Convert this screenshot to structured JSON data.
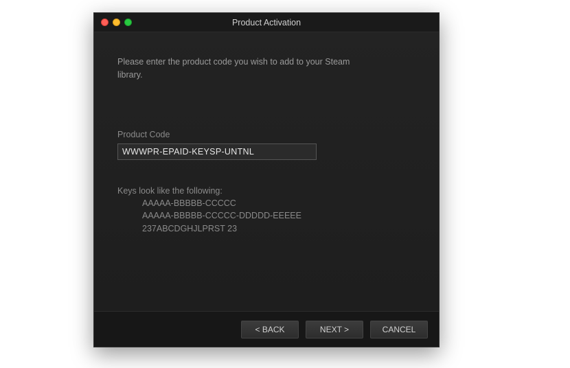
{
  "window": {
    "title": "Product Activation"
  },
  "content": {
    "instruction": "Please enter the product code you wish to add to your Steam library.",
    "field_label": "Product Code",
    "code_value": "WWWPR-EPAID-KEYSP-UNTNL",
    "hint_title": "Keys look like the following:",
    "hint_examples": [
      "AAAAA-BBBBB-CCCCC",
      "AAAAA-BBBBB-CCCCC-DDDDD-EEEEE",
      "237ABCDGHJLPRST 23"
    ]
  },
  "footer": {
    "back": "< BACK",
    "next": "NEXT >",
    "cancel": "CANCEL"
  }
}
